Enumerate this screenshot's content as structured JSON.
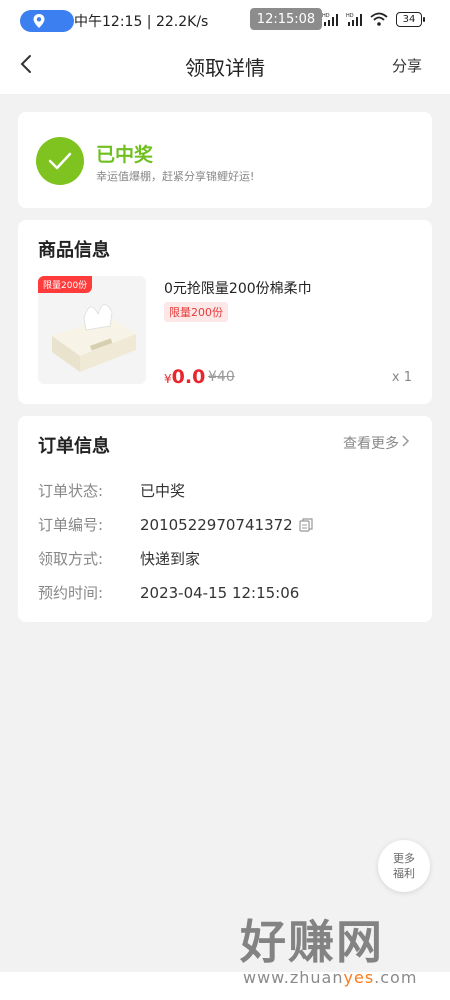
{
  "status_bar": {
    "text": "中午12:15 | 22.2K/s",
    "overlay_time": "12:15:08",
    "network_labels": [
      "HD",
      "HD"
    ],
    "battery": "34"
  },
  "header": {
    "title": "领取详情",
    "share": "分享"
  },
  "result": {
    "title": "已中奖",
    "subtitle": "幸运值爆棚，赶紧分享锦鲤好运!",
    "accent": "#7ec31f"
  },
  "product_section": {
    "title": "商品信息",
    "image_badge": "限量200份",
    "name": "0元抢限量200份棉柔巾",
    "tag": "限量200份",
    "price_currency": "¥",
    "price_now": "0.0",
    "price_old": "¥40",
    "quantity": "x 1",
    "price_color": "#e8262b"
  },
  "order_section": {
    "title": "订单信息",
    "more": "查看更多",
    "rows": [
      {
        "label": "订单状态:",
        "value": "已中奖"
      },
      {
        "label": "订单编号:",
        "value": "2010522970741372"
      },
      {
        "label": "领取方式:",
        "value": "快递到家"
      },
      {
        "label": "预约时间:",
        "value": "2023-04-15 12:15:06"
      }
    ]
  },
  "float_button": {
    "line1": "更多",
    "line2": "福利"
  },
  "watermark": {
    "text": "好赚网",
    "url_prefix": "www.zhuan",
    "url_highlight": "yes",
    "url_suffix": ".com"
  }
}
